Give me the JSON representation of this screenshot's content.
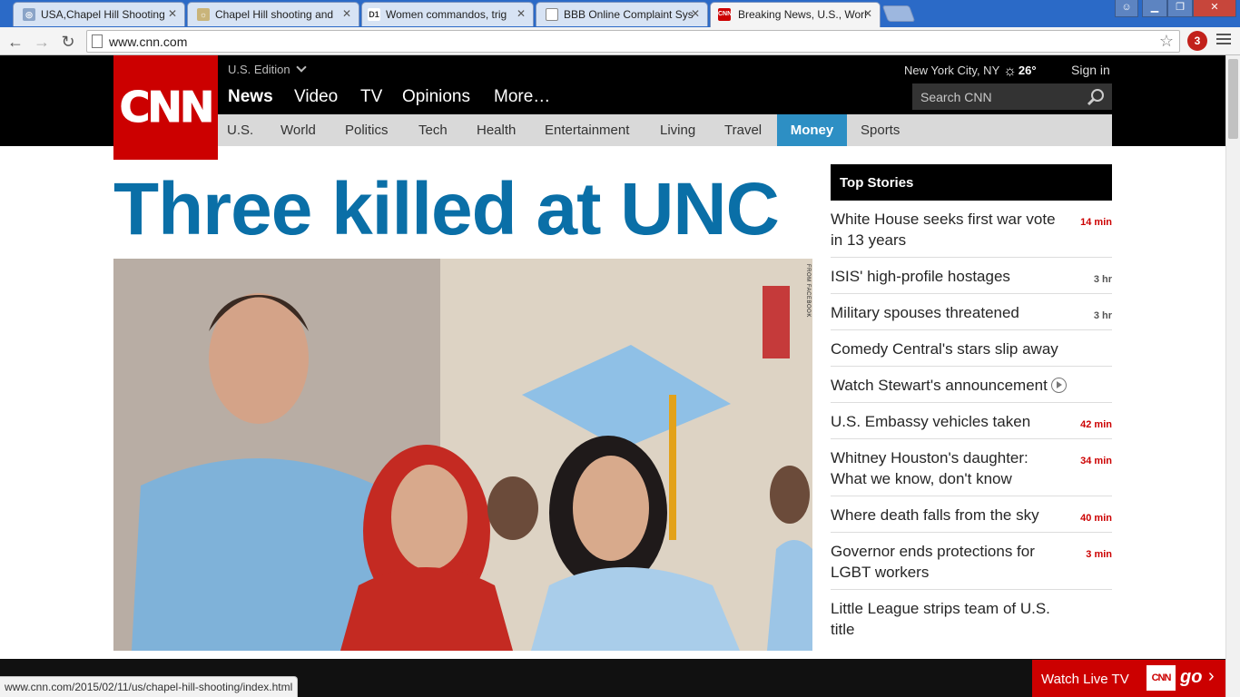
{
  "browser": {
    "tabs": [
      {
        "title": "USA,Chapel Hill Shooting",
        "icon": "globe"
      },
      {
        "title": "Chapel Hill shooting and",
        "icon": "sun"
      },
      {
        "title": "Women commandos, trig",
        "icon": "D1"
      },
      {
        "title": "BBB Online Complaint Sys",
        "icon": "page"
      },
      {
        "title": "Breaking News, U.S., Worl",
        "icon": "CNN"
      }
    ],
    "url": "www.cnn.com",
    "extension_badge": "3",
    "status_url": "www.cnn.com/2015/02/11/us/chapel-hill-shooting/index.html"
  },
  "header": {
    "logo": "CNN",
    "edition": "U.S. Edition",
    "main_nav": [
      "News",
      "Video",
      "TV",
      "Opinions",
      "More…"
    ],
    "weather": {
      "city": "New York City, NY",
      "temp": "26°"
    },
    "sign_in": "Sign in",
    "search_placeholder": "Search CNN",
    "sub_nav": [
      "U.S.",
      "World",
      "Politics",
      "Tech",
      "Health",
      "Entertainment",
      "Living",
      "Travel",
      "Money",
      "Sports"
    ],
    "sub_nav_active": "Money"
  },
  "main": {
    "headline": "Three killed at UNC",
    "photo_credit": "FROM FACEBOOK"
  },
  "top_stories": {
    "title": "Top Stories",
    "items": [
      {
        "text": "White House seeks first war vote in 13 years",
        "time": "14 min"
      },
      {
        "text": "ISIS' high-profile hostages",
        "time": "3 hr"
      },
      {
        "text": "Military spouses threatened",
        "time": "3 hr"
      },
      {
        "text": "Comedy Central's stars slip away",
        "time": ""
      },
      {
        "text": "Watch Stewart's announcement",
        "time": "",
        "video": true
      },
      {
        "text": "U.S. Embassy vehicles taken",
        "time": "42 min"
      },
      {
        "text": "Whitney Houston's daughter: What we know, don't know",
        "time": "34 min"
      },
      {
        "text": "Where death falls from the sky",
        "time": "40 min"
      },
      {
        "text": "Governor ends protections for LGBT workers",
        "time": "3 min"
      },
      {
        "text": "Little League strips team of U.S. title",
        "time": ""
      }
    ]
  },
  "live_tv": {
    "label": "Watch Live TV",
    "brand": "CNN",
    "go": "go",
    "arrow": "›"
  },
  "colors": {
    "cnn_red": "#cc0000",
    "headline_blue": "#0a6fa7",
    "money_blue": "#2d8fc4"
  }
}
